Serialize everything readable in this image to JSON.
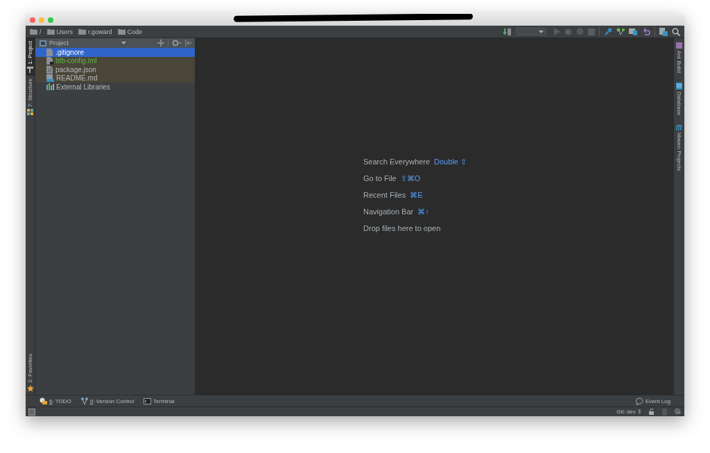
{
  "breadcrumbs": [
    {
      "label": "/"
    },
    {
      "label": "Users"
    },
    {
      "label": "r.goward"
    },
    {
      "label": "Code"
    }
  ],
  "left_tabs": [
    {
      "label": "1: Project",
      "selected": true,
      "kind": "project"
    },
    {
      "label": "7: Structure",
      "selected": false,
      "kind": "structure"
    }
  ],
  "left_bottom_tabs": [
    {
      "label": "2: Favorites",
      "selected": false,
      "kind": "favorites"
    }
  ],
  "right_tabs": [
    {
      "label": "Ant Build",
      "kind": "ant"
    },
    {
      "label": "Database",
      "kind": "database"
    },
    {
      "label": "Maven Projects",
      "kind": "maven"
    }
  ],
  "project_panel": {
    "title": "Project",
    "items": [
      {
        "name": ".gitignore",
        "kind": "file",
        "selected": true,
        "highlighted": true,
        "unversioned": false
      },
      {
        "name": "btb-config.iml",
        "kind": "module",
        "selected": false,
        "highlighted": true,
        "unversioned": true
      },
      {
        "name": "package.json",
        "kind": "json",
        "selected": false,
        "highlighted": true,
        "unversioned": false
      },
      {
        "name": "README.md",
        "kind": "markdown",
        "selected": false,
        "highlighted": true,
        "unversioned": false
      },
      {
        "name": "External Libraries",
        "kind": "library",
        "selected": false,
        "highlighted": false,
        "unversioned": false
      }
    ]
  },
  "editor_hints": [
    {
      "label": "Search Everywhere",
      "shortcut": "Double ⇧"
    },
    {
      "label": "Go to File",
      "shortcut": "⇧⌘O"
    },
    {
      "label": "Recent Files",
      "shortcut": "⌘E"
    },
    {
      "label": "Navigation Bar",
      "shortcut": "⌘↑"
    },
    {
      "label": "Drop files here to open"
    }
  ],
  "bottom_tools": [
    {
      "mnemonic": "6",
      "label": ": TODO",
      "kind": "todo"
    },
    {
      "mnemonic": "9",
      "label": ": Version Control",
      "kind": "vcs"
    },
    {
      "label": "Terminal",
      "kind": "terminal"
    }
  ],
  "event_log": "Event Log",
  "status_bar": {
    "branch": "Git: dev ⇕"
  }
}
